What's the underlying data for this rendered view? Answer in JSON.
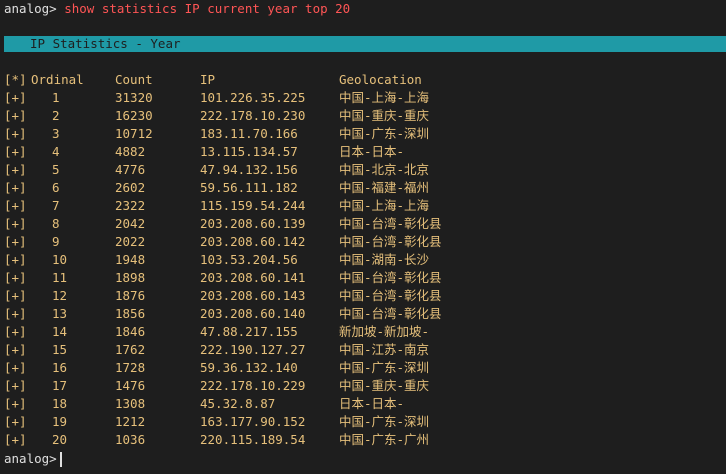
{
  "prompt": "analog>",
  "command": "show statistics IP current year top 20",
  "banner": "IP Statistics - Year",
  "headers": {
    "mark": "[*]",
    "ordinal": "Ordinal",
    "count": "Count",
    "ip": "IP",
    "geo": "Geolocation"
  },
  "rows": [
    {
      "mark": "[+]",
      "ordinal": "1",
      "count": "31320",
      "ip": "101.226.35.225",
      "geo": "中国-上海-上海"
    },
    {
      "mark": "[+]",
      "ordinal": "2",
      "count": "16230",
      "ip": "222.178.10.230",
      "geo": "中国-重庆-重庆"
    },
    {
      "mark": "[+]",
      "ordinal": "3",
      "count": "10712",
      "ip": "183.11.70.166",
      "geo": "中国-广东-深圳"
    },
    {
      "mark": "[+]",
      "ordinal": "4",
      "count": "4882",
      "ip": "13.115.134.57",
      "geo": "日本-日本-"
    },
    {
      "mark": "[+]",
      "ordinal": "5",
      "count": "4776",
      "ip": "47.94.132.156",
      "geo": "中国-北京-北京"
    },
    {
      "mark": "[+]",
      "ordinal": "6",
      "count": "2602",
      "ip": "59.56.111.182",
      "geo": "中国-福建-福州"
    },
    {
      "mark": "[+]",
      "ordinal": "7",
      "count": "2322",
      "ip": "115.159.54.244",
      "geo": "中国-上海-上海"
    },
    {
      "mark": "[+]",
      "ordinal": "8",
      "count": "2042",
      "ip": "203.208.60.139",
      "geo": "中国-台湾-彰化县"
    },
    {
      "mark": "[+]",
      "ordinal": "9",
      "count": "2022",
      "ip": "203.208.60.142",
      "geo": "中国-台湾-彰化县"
    },
    {
      "mark": "[+]",
      "ordinal": "10",
      "count": "1948",
      "ip": "103.53.204.56",
      "geo": "中国-湖南-长沙"
    },
    {
      "mark": "[+]",
      "ordinal": "11",
      "count": "1898",
      "ip": "203.208.60.141",
      "geo": "中国-台湾-彰化县"
    },
    {
      "mark": "[+]",
      "ordinal": "12",
      "count": "1876",
      "ip": "203.208.60.143",
      "geo": "中国-台湾-彰化县"
    },
    {
      "mark": "[+]",
      "ordinal": "13",
      "count": "1856",
      "ip": "203.208.60.140",
      "geo": "中国-台湾-彰化县"
    },
    {
      "mark": "[+]",
      "ordinal": "14",
      "count": "1846",
      "ip": "47.88.217.155",
      "geo": "新加坡-新加坡-"
    },
    {
      "mark": "[+]",
      "ordinal": "15",
      "count": "1762",
      "ip": "222.190.127.27",
      "geo": "中国-江苏-南京"
    },
    {
      "mark": "[+]",
      "ordinal": "16",
      "count": "1728",
      "ip": "59.36.132.140",
      "geo": "中国-广东-深圳"
    },
    {
      "mark": "[+]",
      "ordinal": "17",
      "count": "1476",
      "ip": "222.178.10.229",
      "geo": "中国-重庆-重庆"
    },
    {
      "mark": "[+]",
      "ordinal": "18",
      "count": "1308",
      "ip": "45.32.8.87",
      "geo": "日本-日本-"
    },
    {
      "mark": "[+]",
      "ordinal": "19",
      "count": "1212",
      "ip": "163.177.90.152",
      "geo": "中国-广东-深圳"
    },
    {
      "mark": "[+]",
      "ordinal": "20",
      "count": "1036",
      "ip": "220.115.189.54",
      "geo": "中国-广东-广州"
    }
  ],
  "final_prompt": "analog>",
  "colors": {
    "background": "#1e1e1e",
    "text": "#e6c07b",
    "command": "#ff5555",
    "banner": "#1f9aa6"
  }
}
